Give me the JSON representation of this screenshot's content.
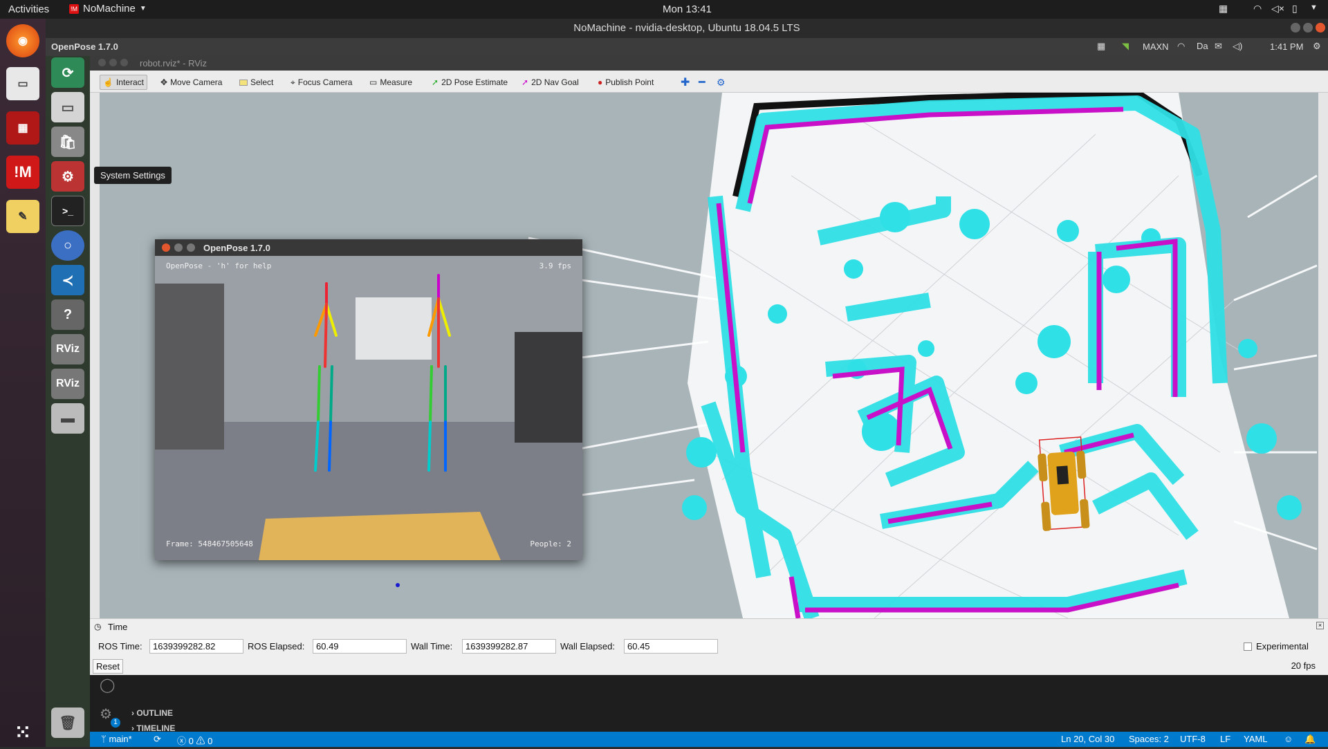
{
  "topbar": {
    "activities": "Activities",
    "app": "NoMachine",
    "clock": "Mon 13:41"
  },
  "nomachine": {
    "window_title": "NoMachine - nvidia-desktop, Ubuntu 18.04.5 LTS",
    "left_label": "OpenPose 1.7.0",
    "power_mode": "MAXN",
    "time": "1:41 PM"
  },
  "tooltip": "System Settings",
  "rviz": {
    "window_title": "robot.rviz* - RViz",
    "tools": [
      "Interact",
      "Move Camera",
      "Select",
      "Focus Camera",
      "Measure",
      "2D Pose Estimate",
      "2D Nav Goal",
      "Publish Point"
    ]
  },
  "openpose": {
    "title": "OpenPose 1.7.0",
    "help": "OpenPose - 'h' for help",
    "fps": "3.9 fps",
    "frame": "Frame: 548467505648",
    "people": "People: 2"
  },
  "time_panel": {
    "title": "Time",
    "ros_time_label": "ROS Time:",
    "ros_time": "1639399282.82",
    "ros_elapsed_label": "ROS Elapsed:",
    "ros_elapsed": "60.49",
    "wall_time_label": "Wall Time:",
    "wall_time": "1639399282.87",
    "wall_elapsed_label": "Wall Elapsed:",
    "wall_elapsed": "60.45",
    "experimental": "Experimental",
    "reset": "Reset",
    "fps": "20 fps"
  },
  "vscode": {
    "outline": "OUTLINE",
    "timeline": "TIMELINE",
    "badge": "1",
    "status": {
      "branch": "main*",
      "errors": "0",
      "warnings": "0",
      "position": "Ln 20, Col 30",
      "spaces": "Spaces: 2",
      "encoding": "UTF-8",
      "eol": "LF",
      "language": "YAML"
    }
  },
  "colors": {
    "accent": "#007acc",
    "costmap_inflation": "#2fe0e6",
    "costmap_lethal": "#c810c8",
    "robot": "#e0a21a"
  }
}
